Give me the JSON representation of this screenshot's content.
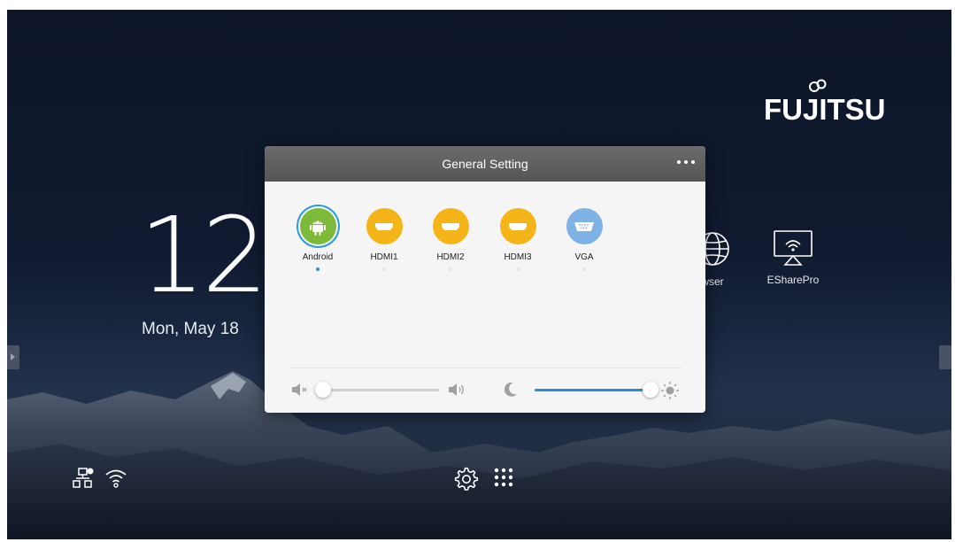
{
  "brand": {
    "name": "FUJITSU"
  },
  "clock": {
    "time": "12",
    "date": "Mon, May 18"
  },
  "apps": [
    {
      "label": "wser",
      "icon": "globe-icon"
    },
    {
      "label": "ESharePro",
      "icon": "screen-cast-icon"
    }
  ],
  "dialog": {
    "title": "General Setting",
    "sources": [
      {
        "label": "Android",
        "icon": "android-icon",
        "color": "#7dba3a",
        "selected": true
      },
      {
        "label": "HDMI1",
        "icon": "hdmi-icon",
        "color": "#f5b417",
        "selected": false
      },
      {
        "label": "HDMI2",
        "icon": "hdmi-icon",
        "color": "#f5b417",
        "selected": false
      },
      {
        "label": "HDMI3",
        "icon": "hdmi-icon",
        "color": "#f5b417",
        "selected": false
      },
      {
        "label": "VGA",
        "icon": "vga-icon",
        "color": "#7fb2e5",
        "selected": false
      }
    ],
    "volume": {
      "level": 0.0
    },
    "brightness": {
      "level": 1.0
    }
  },
  "colors": {
    "accent": "#2d8fd0",
    "slider_fill": "#2d8fd0",
    "slider_track": "#cfcfcf"
  }
}
